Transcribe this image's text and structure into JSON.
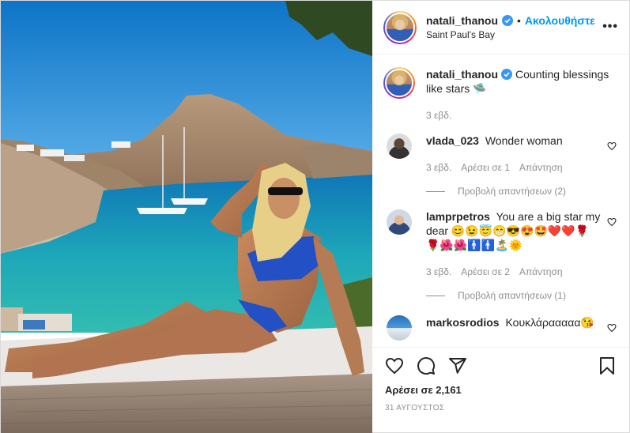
{
  "post": {
    "username": "natali_thanou",
    "follow_label": "Ακολουθήστε",
    "dot": "•",
    "location": "Saint Paul's Bay",
    "more_label": "•••",
    "caption_text": "Counting blessings like stars",
    "caption_emoji": "🛸",
    "caption_time": "3 εβδ.",
    "likes_label": "Αρέσει σε 2,161",
    "date_label": "31 ΑΥΓΟΥΣΤΟΣ",
    "verified_color": "#3897f0",
    "follow_color": "#0095f6"
  },
  "comments": [
    {
      "username": "vlada_023",
      "text": "Wonder woman",
      "time": "3 εβδ.",
      "likes": "Αρέσει σε 1",
      "reply": "Απάντηση",
      "view_replies": "Προβολή απαντήσεων (2)"
    },
    {
      "username": "lamprpetros",
      "text": "You are a big star my dear 😊😉😇😁😎😍🤩❤️❤️🌹🌹🌺🌺🚹🚹🏝️🌞",
      "time": "3 εβδ.",
      "likes": "Αρέσει σε 2",
      "reply": "Απάντηση",
      "view_replies": "Προβολή απαντήσεων (1)"
    },
    {
      "username": "markosrodios",
      "text": "Κουκλάρααααα😘"
    }
  ],
  "icons": {
    "like": "heart-icon",
    "comment": "comment-icon",
    "share": "share-icon",
    "save": "bookmark-icon"
  }
}
